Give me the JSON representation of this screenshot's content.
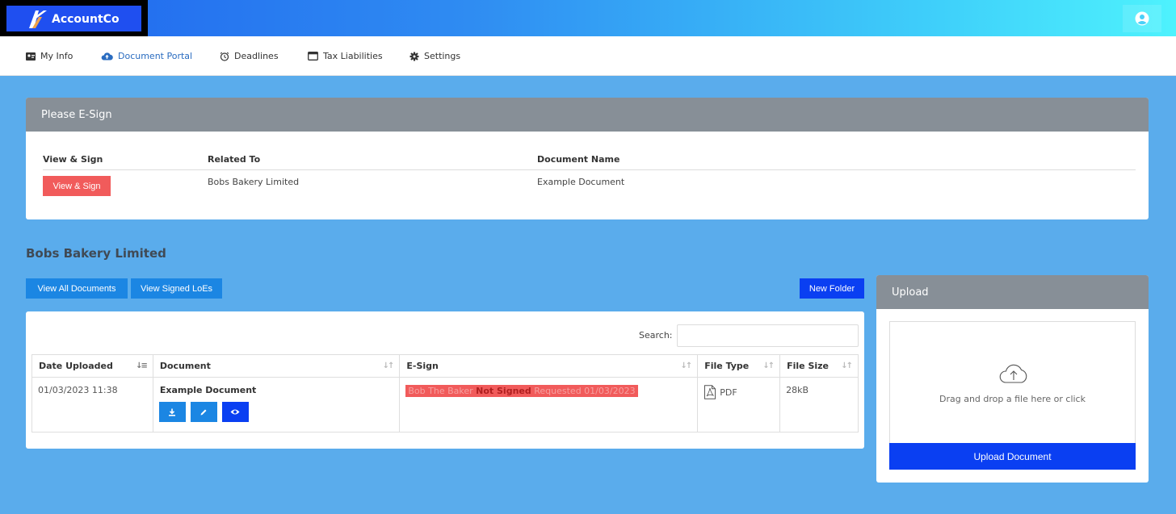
{
  "brand": {
    "logo_text": "AccountCo"
  },
  "nav": {
    "items": [
      {
        "label": "My Info",
        "icon": "id-card-icon"
      },
      {
        "label": "Document Portal",
        "icon": "cloud-upload-icon",
        "active": true
      },
      {
        "label": "Deadlines",
        "icon": "alarm-clock-icon"
      },
      {
        "label": "Tax Liabilities",
        "icon": "window-icon"
      },
      {
        "label": "Settings",
        "icon": "gear-icon"
      }
    ]
  },
  "esign": {
    "title": "Please E-Sign",
    "columns": [
      "View & Sign",
      "Related To",
      "Document Name"
    ],
    "row": {
      "button_label": "View & Sign",
      "related_to": "Bobs Bakery Limited",
      "document_name": "Example Document"
    }
  },
  "company": {
    "name": "Bobs Bakery Limited"
  },
  "toolbar": {
    "view_all_label": "View All Documents",
    "view_signed_label": "View Signed LoEs",
    "new_folder_label": "New Folder"
  },
  "documents": {
    "search_label": "Search:",
    "search_value": "",
    "columns": [
      "Date Uploaded",
      "Document",
      "E-Sign",
      "File Type",
      "File Size"
    ],
    "rows": [
      {
        "date": "01/03/2023 11:38",
        "name": "Example Document",
        "esign_signer": "Bob The Baker",
        "esign_status": "Not Signed",
        "esign_requested": "Requested 01/03/2023",
        "file_type": "PDF",
        "file_size": "28kB"
      }
    ]
  },
  "upload": {
    "title": "Upload",
    "drop_text": "Drag and drop a file here or click",
    "button_label": "Upload Document"
  },
  "colors": {
    "background": "#5aacec",
    "primary": "#1b86e3",
    "navy": "#0a3ff2",
    "danger": "#f15b5b",
    "card_header": "#878f97"
  }
}
